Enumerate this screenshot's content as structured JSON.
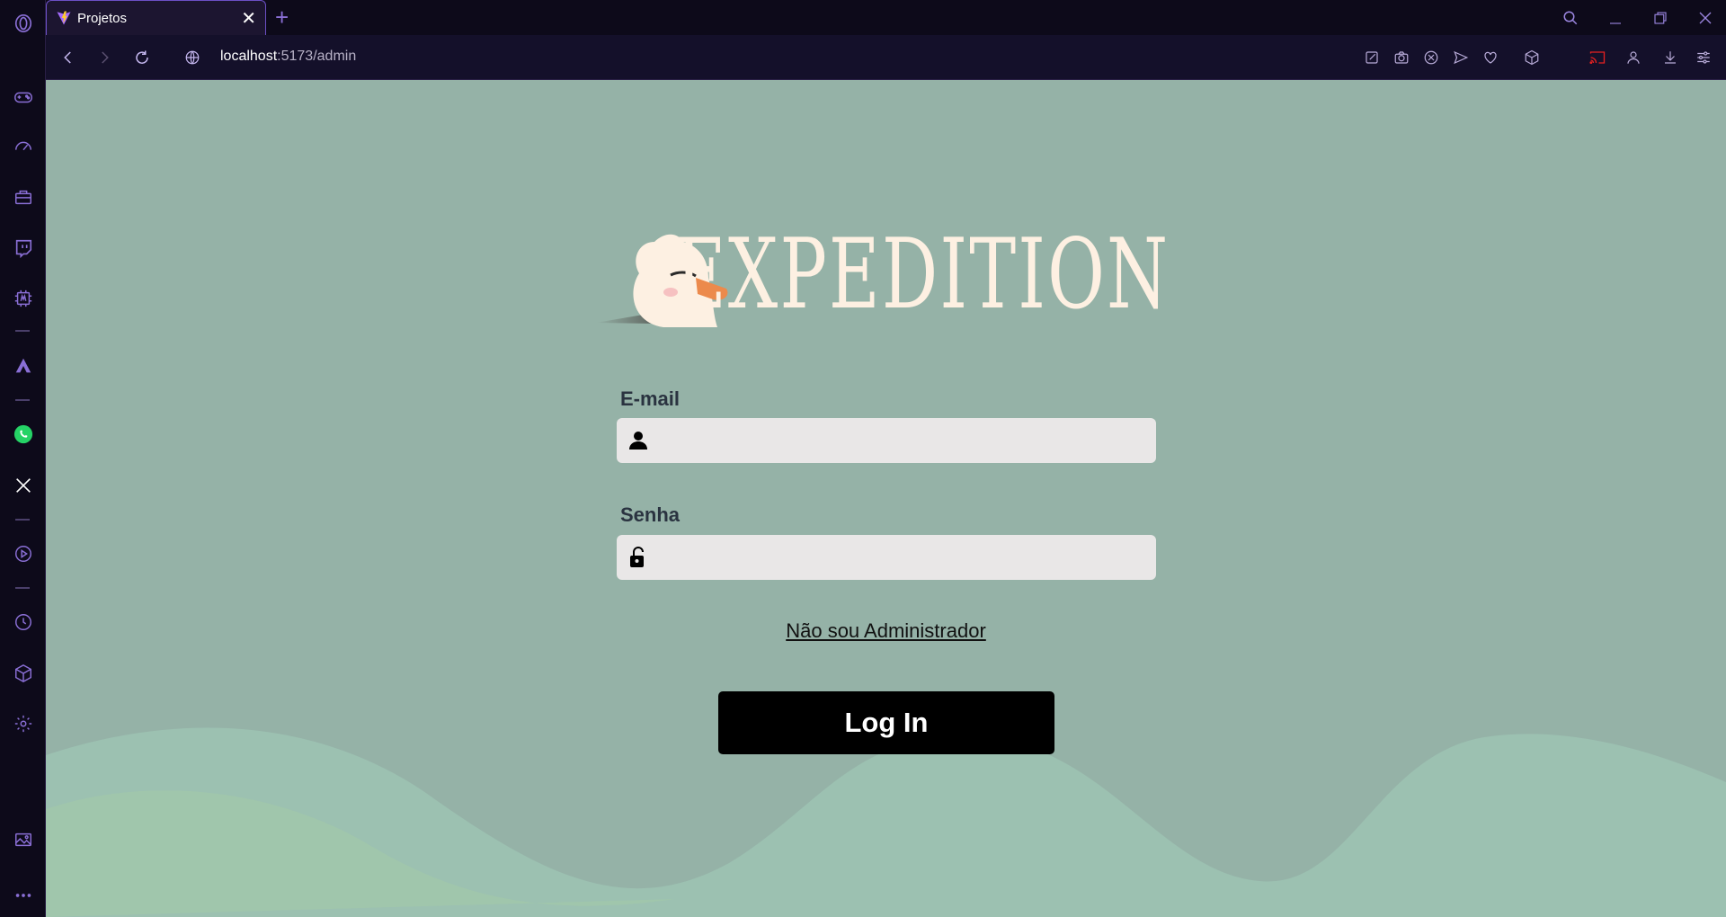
{
  "browser": {
    "tab_title": "Projetos",
    "new_tab_symbol": "+",
    "url_host": "localhost",
    "url_path": ":5173/admin"
  },
  "sidebar": {
    "icons": [
      "opera-logo-icon",
      "gamepad-icon",
      "speedometer-icon",
      "bag-icon",
      "twitch-icon",
      "ai-chip-icon",
      "aria-icon",
      "whatsapp-icon",
      "x-icon",
      "player-icon",
      "history-icon",
      "box-icon",
      "settings-icon",
      "gallery-icon",
      "more-icon"
    ]
  },
  "colors": {
    "page_bg": "#95b2a7",
    "logo_text": "#fdf0e2",
    "button_bg": "#000000",
    "input_bg": "#e9e7e7",
    "accent": "#8a6fd6"
  },
  "logo": {
    "text": "EXPEDITION"
  },
  "form": {
    "email_label": "E-mail",
    "email_value": "",
    "password_label": "Senha",
    "password_value": "",
    "not_admin_link": "Não sou Administrador",
    "login_button": "Log In"
  }
}
